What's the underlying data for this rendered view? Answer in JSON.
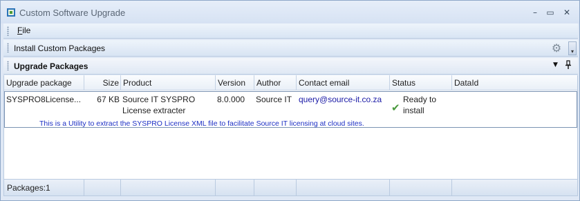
{
  "window": {
    "title": "Custom Software Upgrade",
    "minimize": "–",
    "maximize": "▭",
    "close": "✕"
  },
  "menu": {
    "file_label": "File",
    "file_accel": "F",
    "file_rest": "ile"
  },
  "toolbar": {
    "install_label": "Install Custom Packages",
    "gear_icon": "⚙",
    "overflow_icon": "▾"
  },
  "panel": {
    "title": "Upgrade Packages",
    "dropdown_icon": "▼",
    "pin_icon": "📌"
  },
  "grid": {
    "columns": [
      "Upgrade package",
      "Size",
      "Product",
      "Version",
      "Author",
      "Contact email",
      "Status",
      "DataId"
    ],
    "rows": [
      {
        "package": "SYSPRO8License...",
        "size": "67 KB",
        "product_line1": "Source IT SYSPRO",
        "product_line2": "License extracter",
        "version": "8.0.000",
        "author": "Source IT",
        "email": "query@source-it.co.za",
        "status_line1": "Ready to",
        "status_line2": "install",
        "status_icon": "✔",
        "dataid": "",
        "description": "This is a Utility to extract the SYSPRO License XML file to facilitate Source IT licensing at cloud sites."
      }
    ]
  },
  "footer": {
    "packages_label": "Packages:1"
  },
  "colors": {
    "accent": "#2a73b8",
    "email_link": "#1a1aa6",
    "description": "#1c2fc4",
    "status_ok": "#4a9a3e"
  }
}
